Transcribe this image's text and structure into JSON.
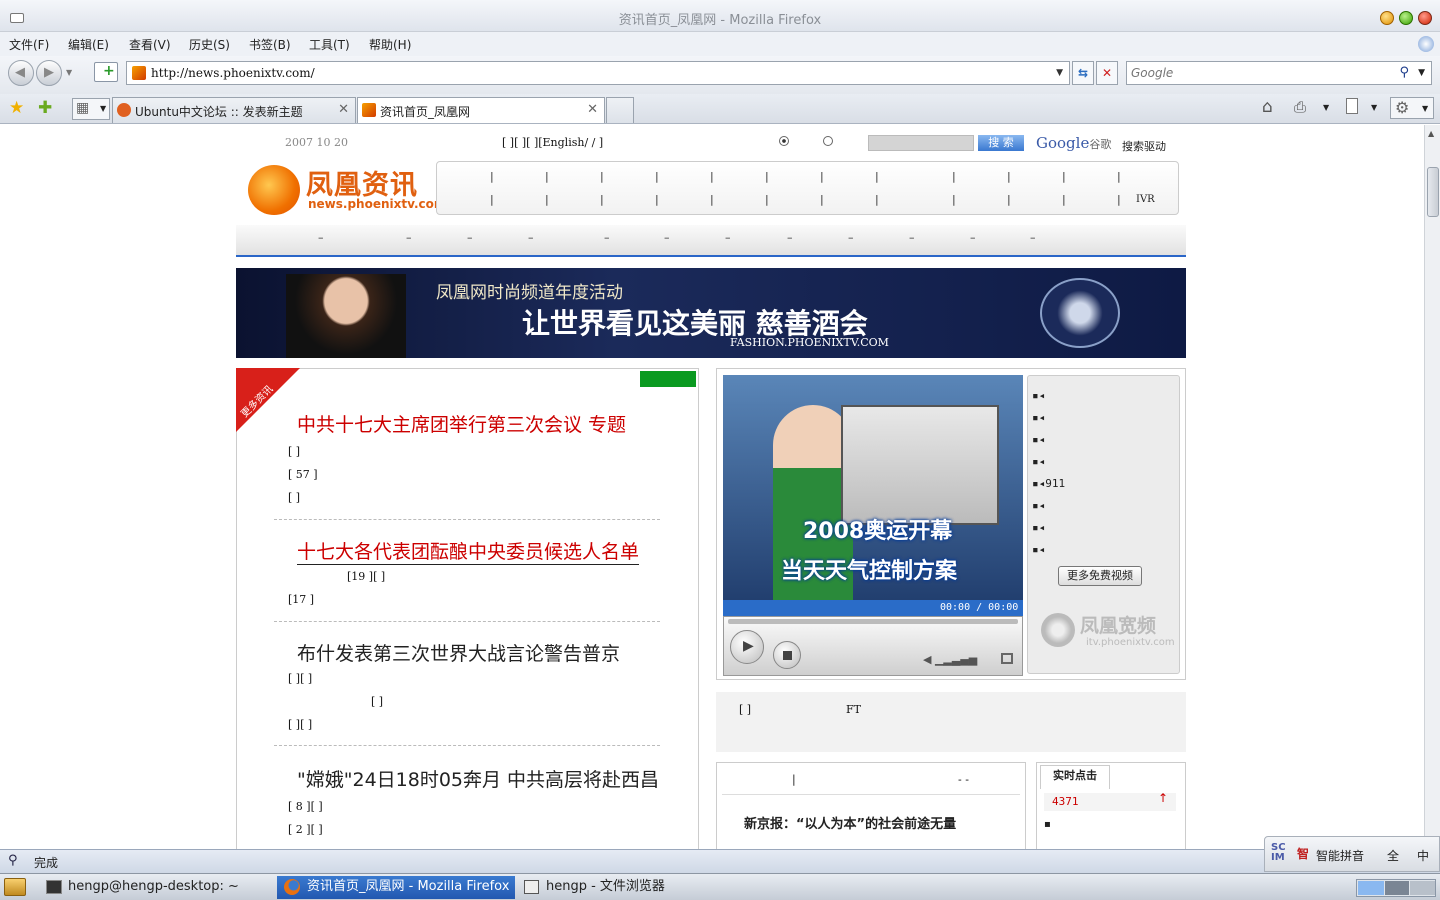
{
  "window": {
    "title": "资讯首页_凤凰网 - Mozilla Firefox"
  },
  "menu": [
    "文件(F)",
    "编辑(E)",
    "查看(V)",
    "历史(S)",
    "书签(B)",
    "工具(T)",
    "帮助(H)"
  ],
  "nav": {
    "url": "http://news.phoenixtv.com/",
    "search_placeholder": "Google"
  },
  "tabs": [
    {
      "label": "Ubuntu中文论坛 :: 发表新主题"
    },
    {
      "label": "资讯首页_凤凰网"
    }
  ],
  "page": {
    "date": "2007  10  20",
    "top_links": "[    ][    ][        ][English/  /    ]",
    "search_button": "搜 索",
    "google_label": "Google",
    "google_cn": "谷歌",
    "search_driven": "搜索驱动",
    "logo_cn": "凤凰资讯",
    "logo_en": "news.phoenixtv.com",
    "ivr": "IVR",
    "banner_line1": "凤凰网时尚频道年度活动",
    "banner_line2": "让世界看见这美丽  慈善酒会",
    "banner_url": "FASHION.PHOENIXTV.COM",
    "more_news_ribbon": "更多资讯",
    "headlines": [
      {
        "title": "中共十七大主席团举行第三次会议 专题",
        "lines": [
          "[                                               ]",
          "[                                  57  ]",
          "[                                              ]"
        ]
      },
      {
        "title": "十七大各代表团酝酿中央委员候选人名单",
        "lines": [
          "[19                       ][                   ]",
          "[17                                              ]"
        ]
      },
      {
        "title": "布什发表第三次世界大战言论警告普京",
        "lines": [
          "[                              ][                ]",
          "[                                  ]",
          "[                     ][                     ]"
        ]
      },
      {
        "title": "\"嫦娥\"24日18时05奔月 中共高层将赴西昌",
        "lines": [
          "[                       8  ][                          ]",
          "[                            2  ][                    ]"
        ]
      }
    ],
    "video": {
      "headline1": "2008奥运开幕",
      "headline2": "当天天气控制方案",
      "time": "00:00 / 00:00",
      "more_button": "更多免费视频",
      "brand_cn": "凤凰宽频",
      "brand_en": "itv.phoenixtv.com",
      "list": [
        "",
        "",
        "",
        "",
        "911",
        "",
        "",
        ""
      ]
    },
    "ft_box": {
      "bracket": "[    ]",
      "ft": "FT"
    },
    "news_box": {
      "headline": "新京报：“以人为本”的社会前途无量"
    },
    "realtime": {
      "tab": "实时点击",
      "count": "4371"
    }
  },
  "status": {
    "text": "完成"
  },
  "taskbar": [
    {
      "label": "hengp@hengp-desktop: ~"
    },
    {
      "label": "资讯首页_凤凰网 - Mozilla Firefox"
    },
    {
      "label": "hengp - 文件浏览器"
    }
  ],
  "ime": {
    "name": "智能拼音",
    "full": "全",
    "lang": "中"
  }
}
